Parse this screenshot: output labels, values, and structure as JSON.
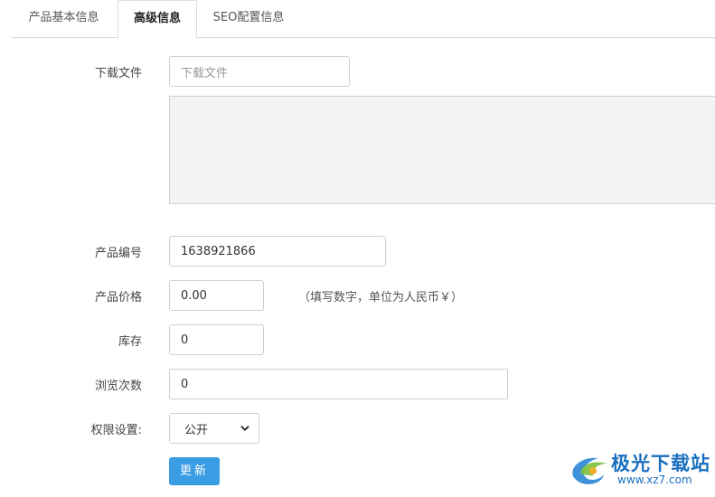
{
  "tabs": [
    {
      "label": "产品基本信息",
      "active": false
    },
    {
      "label": "高级信息",
      "active": true
    },
    {
      "label": "SEO配置信息",
      "active": false
    }
  ],
  "form": {
    "download_file": {
      "label": "下载文件",
      "placeholder": "下载文件",
      "value": ""
    },
    "product_code": {
      "label": "产品编号",
      "value": "1638921866"
    },
    "product_price": {
      "label": "产品价格",
      "value": "0.00",
      "hint": "（填写数字，单位为人民币￥）"
    },
    "stock": {
      "label": "库存",
      "value": "0"
    },
    "view_count": {
      "label": "浏览次数",
      "value": "0"
    },
    "permission": {
      "label": "权限设置:",
      "selected": "公开"
    },
    "submit_label": "更新"
  },
  "watermark": {
    "name": "极光下载站",
    "url": "www.xz7.com"
  },
  "colors": {
    "accent": "#3a9de4",
    "upload_bg": "#f3f3f3",
    "watermark": "#1a6fbf"
  }
}
